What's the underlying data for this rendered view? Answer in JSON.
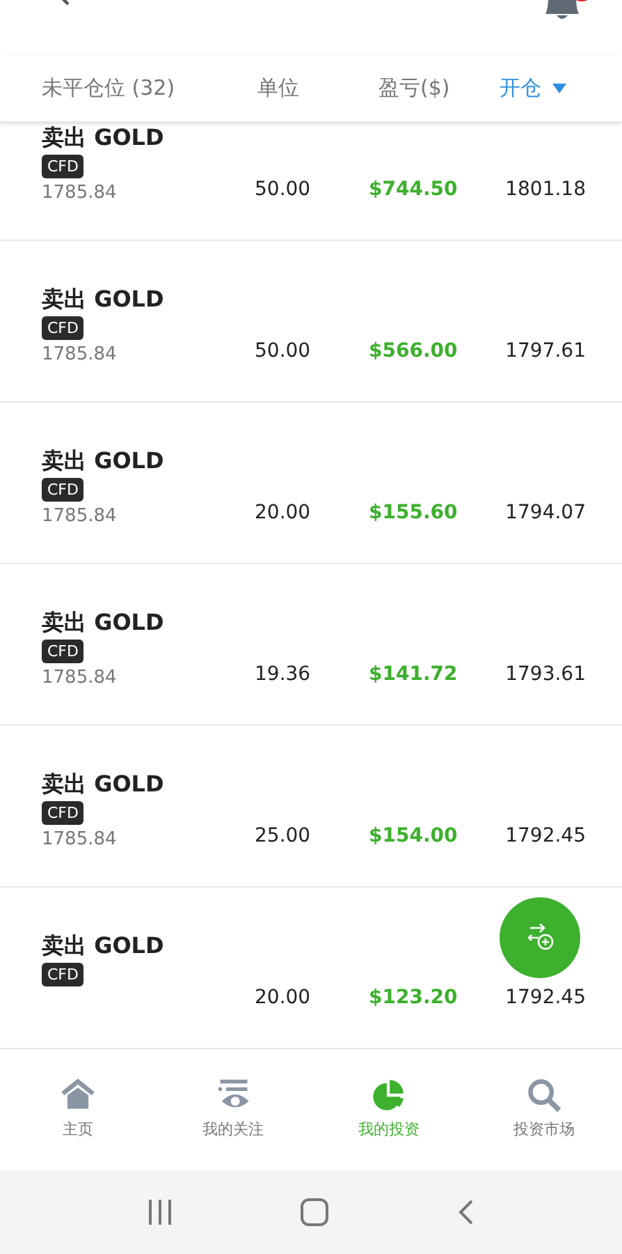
{
  "header": {
    "title": "未平仓位 (32)",
    "columns": [
      "单位",
      "盈亏($)"
    ],
    "sort_column": {
      "label": "开仓"
    }
  },
  "positions": [
    {
      "title": "卖出 GOLD",
      "tag": "CFD",
      "price": "1785.84",
      "units": "50.00",
      "pnl": "$744.50",
      "open": "1801.18"
    },
    {
      "title": "卖出 GOLD",
      "tag": "CFD",
      "price": "1785.84",
      "units": "50.00",
      "pnl": "$566.00",
      "open": "1797.61"
    },
    {
      "title": "卖出 GOLD",
      "tag": "CFD",
      "price": "1785.84",
      "units": "20.00",
      "pnl": "$155.60",
      "open": "1794.07"
    },
    {
      "title": "卖出 GOLD",
      "tag": "CFD",
      "price": "1785.84",
      "units": "19.36",
      "pnl": "$141.72",
      "open": "1793.61"
    },
    {
      "title": "卖出 GOLD",
      "tag": "CFD",
      "price": "1785.84",
      "units": "25.00",
      "pnl": "$154.00",
      "open": "1792.45"
    },
    {
      "title": "卖出 GOLD",
      "tag": "CFD",
      "units": "20.00",
      "pnl": "$123.20",
      "open": "1792.45"
    }
  ],
  "bottom_nav": [
    {
      "kind": "home",
      "label": "主页",
      "selected": false
    },
    {
      "kind": "watch",
      "label": "我的关注",
      "selected": false
    },
    {
      "kind": "portfolio",
      "label": "我的投资",
      "selected": true
    },
    {
      "kind": "market",
      "label": "投资市场",
      "selected": false
    }
  ]
}
